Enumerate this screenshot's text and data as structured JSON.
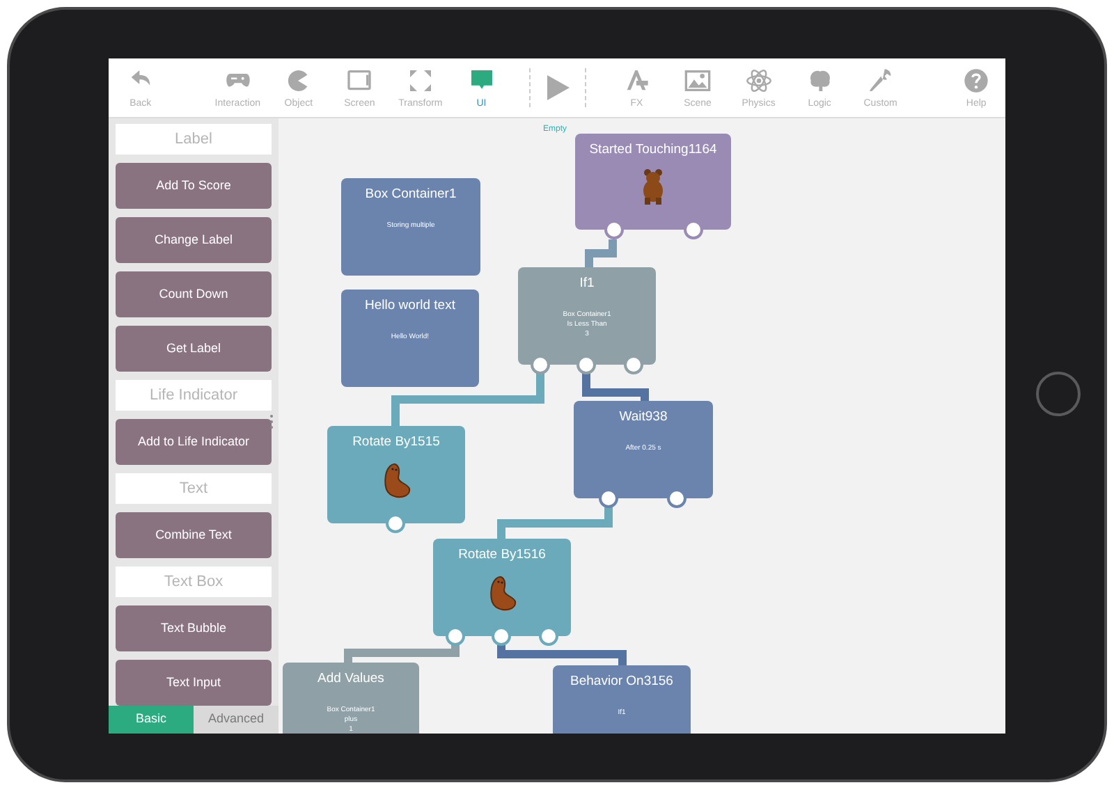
{
  "toolbar": [
    {
      "label": "Back",
      "kind": "tool",
      "selected": false
    },
    {
      "label": "Interaction",
      "kind": "tool",
      "selected": false
    },
    {
      "label": "Object",
      "kind": "tool",
      "selected": false
    },
    {
      "label": "Screen",
      "kind": "tool",
      "selected": false
    },
    {
      "label": "Transform",
      "kind": "tool",
      "selected": false
    },
    {
      "label": "UI",
      "kind": "tool",
      "selected": true
    },
    {
      "kind": "play"
    },
    {
      "label": "FX",
      "kind": "tool",
      "selected": false
    },
    {
      "label": "Scene",
      "kind": "tool",
      "selected": false
    },
    {
      "label": "Physics",
      "kind": "tool",
      "selected": false
    },
    {
      "label": "Logic",
      "kind": "tool",
      "selected": false
    },
    {
      "label": "Custom",
      "kind": "tool",
      "selected": false
    },
    {
      "label": "Help",
      "kind": "tool",
      "selected": false
    }
  ],
  "sidebar": {
    "items": [
      {
        "kind": "header",
        "label": "Label"
      },
      {
        "kind": "block",
        "label": "Add To Score"
      },
      {
        "kind": "block",
        "label": "Change Label"
      },
      {
        "kind": "block",
        "label": "Count Down"
      },
      {
        "kind": "block",
        "label": "Get Label"
      },
      {
        "kind": "header",
        "label": "Life Indicator"
      },
      {
        "kind": "block",
        "label": "Add to Life Indicator"
      },
      {
        "kind": "header",
        "label": "Text"
      },
      {
        "kind": "block",
        "label": "Combine Text"
      },
      {
        "kind": "header",
        "label": "Text Box"
      },
      {
        "kind": "block",
        "label": "Text Bubble"
      },
      {
        "kind": "block",
        "label": "Text Input"
      }
    ],
    "tabs": [
      {
        "label": "Basic",
        "selected": true
      },
      {
        "label": "Advanced",
        "selected": false
      }
    ]
  },
  "canvas": {
    "empty_label": "Empty",
    "nodes": [
      {
        "title": "Started Touching1164",
        "kind": "touch",
        "color": "#9a8bb5"
      },
      {
        "title": "Box Container1",
        "kind": "info",
        "detail": "Storing multiple",
        "color": "#6b84ad"
      },
      {
        "title": "Hello world text",
        "kind": "info",
        "detail": "Hello World!",
        "color": "#6b84ad"
      },
      {
        "title": "If1",
        "kind": "info",
        "detail": "Box Container1\nIs Less Than\n3",
        "color": "#8fa0a6"
      },
      {
        "title": "Rotate By1515",
        "kind": "rotate",
        "color": "#6aaabb"
      },
      {
        "title": "Wait938",
        "kind": "info",
        "detail": "After 0.25 s",
        "color": "#6b84ad"
      },
      {
        "title": "Rotate By1516",
        "kind": "rotate",
        "color": "#6aaabb"
      },
      {
        "title": "Add Values",
        "kind": "info",
        "detail": "Box Container1\nplus\n1",
        "color": "#8fa0a6"
      },
      {
        "title": "Behavior On3156",
        "kind": "info",
        "detail": "If1",
        "color": "#6b84ad"
      }
    ]
  }
}
